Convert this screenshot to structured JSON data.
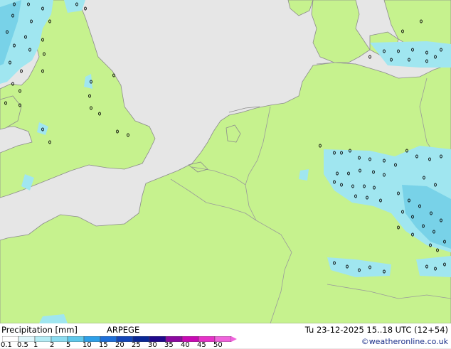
{
  "map": {
    "region": "Western Europe",
    "colors": {
      "sea": "#e6e6e6",
      "land": "#c6f28e",
      "border": "#9a9a9a",
      "coast": "#8c8c8c",
      "precip_light": "#a0e6f0",
      "precip_mid": "#78d2e8",
      "precip_heavy": "#4cc4dc",
      "drop_marker": "#000000"
    },
    "icons": [
      "precipitation-drop-marker"
    ]
  },
  "footer": {
    "legend_title": "Precipitation [mm]",
    "model": "ARPEGE",
    "valid_time": "Tu 23-12-2025 15..18 UTC (12+54)",
    "credit": "©weatheronline.co.uk"
  },
  "legend": {
    "ticks": [
      "0.1",
      "0.5",
      "1",
      "2",
      "5",
      "10",
      "15",
      "20",
      "25",
      "30",
      "35",
      "40",
      "45",
      "50"
    ],
    "colors": [
      "#ffffff",
      "#dff6fb",
      "#b4ecf5",
      "#8cdcf0",
      "#5fc8eb",
      "#2ea0e8",
      "#1e6fd8",
      "#1446b8",
      "#0a2896",
      "#200a8c",
      "#8c0aa0",
      "#c80ab4",
      "#e632c8",
      "#f064dc"
    ]
  }
}
